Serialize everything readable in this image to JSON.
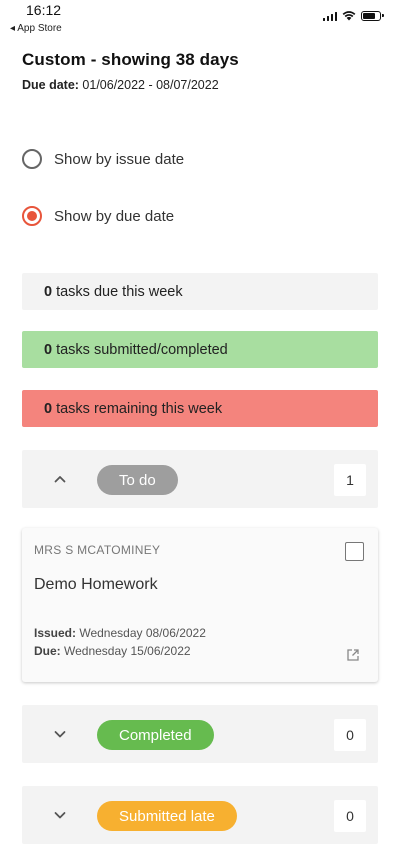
{
  "status_bar": {
    "time": "16:12",
    "back_label": "◂ App Store"
  },
  "header": {
    "title": "Custom - showing 38 days",
    "due_label": "Due date:",
    "due_range": " 01/06/2022 - 08/07/2022"
  },
  "view_options": [
    {
      "label": "Show by issue date",
      "selected": false
    },
    {
      "label": "Show by due date",
      "selected": true
    }
  ],
  "summary": {
    "due_week": {
      "count": "0",
      "text": "tasks due this week"
    },
    "submitted": {
      "count": "0",
      "text": "tasks submitted/completed"
    },
    "remaining": {
      "count": "0",
      "text": "tasks remaining this week"
    }
  },
  "groups": [
    {
      "label": "To do",
      "count": "1",
      "expanded": true,
      "color": "#9e9e9e"
    },
    {
      "label": "Completed",
      "count": "0",
      "expanded": false,
      "color": "#66bb4f"
    },
    {
      "label": "Submitted late",
      "count": "0",
      "expanded": false,
      "color": "#f7b030"
    }
  ],
  "task": {
    "teacher": "MRS S MCATOMINEY",
    "title": "Demo Homework",
    "issued_label": "Issued:",
    "issued": " Wednesday 08/06/2022",
    "due_label": "Due:",
    "due": " Wednesday 15/06/2022",
    "completed": false
  },
  "colors": {
    "accent": "#e8553b",
    "submitted_bg": "#a8dea0",
    "remaining_bg": "#f4847d",
    "neutral_bg": "#f3f3f3"
  },
  "icons": [
    "signal-icon",
    "wifi-icon",
    "battery-icon",
    "chevron-up-icon",
    "chevron-down-icon",
    "external-link-icon"
  ]
}
